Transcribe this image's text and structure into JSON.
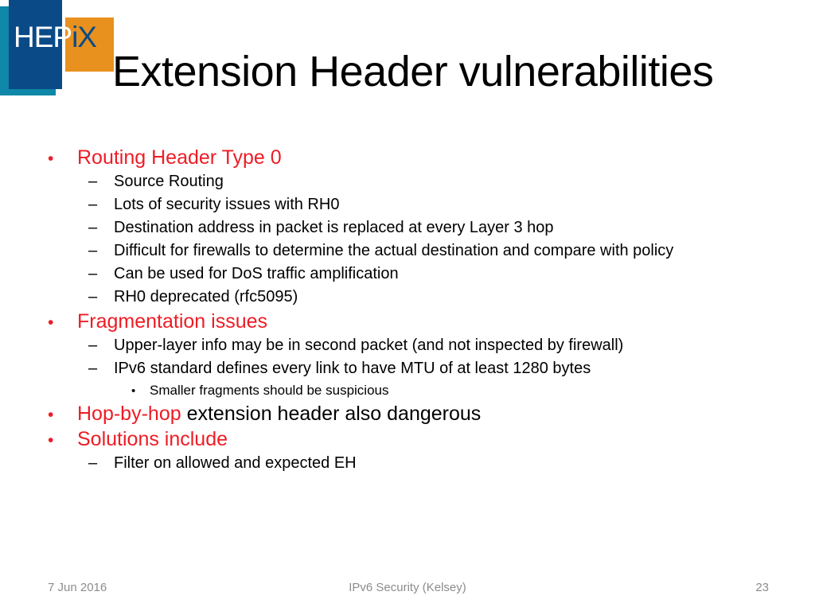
{
  "logo": {
    "text_primary": "HEP",
    "text_secondary": "iX",
    "colors": {
      "teal": "#0e87a8",
      "blue": "#0a4a87",
      "orange": "#e8911e",
      "white": "#ffffff"
    }
  },
  "title": "Extension Header vulnerabilities",
  "theme": {
    "accent_red": "#ee1c25",
    "body_black": "#000000",
    "footer_gray": "#8c8c8c"
  },
  "bullets": {
    "b1": {
      "marker": "•",
      "text": "Routing Header Type 0"
    },
    "b1s1": {
      "marker": "–",
      "text": "Source Routing"
    },
    "b1s2": {
      "marker": "–",
      "text": "Lots of security issues with RH0"
    },
    "b1s3": {
      "marker": "–",
      "text": "Destination address in packet is replaced at every Layer 3 hop"
    },
    "b1s4": {
      "marker": "–",
      "text": "Difficult for firewalls to determine the actual destination and compare with policy"
    },
    "b1s5": {
      "marker": "–",
      "text": "Can be used for DoS traffic amplification"
    },
    "b1s6": {
      "marker": "–",
      "text": "RH0 deprecated (rfc5095)"
    },
    "b2": {
      "marker": "•",
      "text": "Fragmentation issues"
    },
    "b2s1": {
      "marker": "–",
      "text": "Upper-layer info may be in second packet (and not inspected by firewall)"
    },
    "b2s2": {
      "marker": "–",
      "text": "IPv6 standard defines every link to have MTU of at least 1280 bytes"
    },
    "b2s2s1": {
      "marker": "•",
      "text": "Smaller fragments should be suspicious"
    },
    "b3": {
      "marker": "•",
      "text_red": "Hop-by-hop",
      "text_black": " extension header also dangerous"
    },
    "b4": {
      "marker": "•",
      "text": "Solutions include"
    },
    "b4s1": {
      "marker": "–",
      "text": "Filter on allowed and expected EH"
    }
  },
  "footer": {
    "date": "7 Jun 2016",
    "center": "IPv6 Security (Kelsey)",
    "slide_number": "23"
  }
}
